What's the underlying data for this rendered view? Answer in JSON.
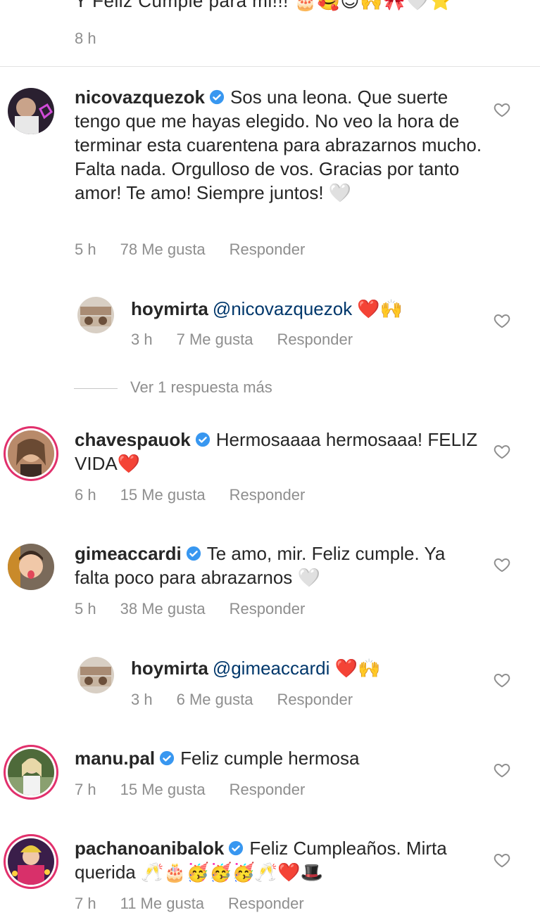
{
  "top": {
    "text": "Y Feliz Cumple para mi!!! 🎂🥰😇🙌🎀🤍⭐",
    "time": "8 h"
  },
  "comments": [
    {
      "username": "nicovazquezok",
      "text": "Sos una leona. Que suerte tengo que me hayas elegido. No veo la hora de terminar esta cuarentena para abrazarnos mucho. Falta nada. Orgulloso de vos. Gracias por tanto amor! Te amo! Siempre juntos! ",
      "emoji": "🤍",
      "time": "5 h",
      "likes": "78 Me gusta",
      "reply": "Responder"
    },
    {
      "username": "hoymirta",
      "mention": "@nicovazquezok",
      "text": "",
      "emoji": " ❤️🙌",
      "time": "3 h",
      "likes": "7 Me gusta",
      "reply": "Responder"
    },
    {
      "username": "chavespauok",
      "text": "Hermosaaaa hermosaaa! FELIZ VIDA",
      "emoji": "❤️",
      "time": "6 h",
      "likes": "15 Me gusta",
      "reply": "Responder"
    },
    {
      "username": "gimeaccardi",
      "text": "Te amo, mir. Feliz cumple. Ya falta poco para abrazarnos ",
      "emoji": "🤍",
      "time": "5 h",
      "likes": "38 Me gusta",
      "reply": "Responder"
    },
    {
      "username": "hoymirta",
      "mention": "@gimeaccardi",
      "text": "",
      "emoji": " ❤️🙌",
      "time": "3 h",
      "likes": "6 Me gusta",
      "reply": "Responder"
    },
    {
      "username": "manu.pal",
      "text": "Feliz cumple hermosa",
      "emoji": "",
      "time": "7 h",
      "likes": "15 Me gusta",
      "reply": "Responder"
    },
    {
      "username": "pachanoanibalok",
      "text": "Feliz Cumpleaños. Mirta querida ",
      "emoji": "🥂🎂🥳🥳🥳🥂❤️🎩",
      "time": "7 h",
      "likes": "11 Me gusta",
      "reply": "Responder"
    }
  ],
  "view_more": "Ver 1 respuesta más",
  "colors": {
    "verified": "#3897f0",
    "story_ring": "#e1306c",
    "muted": "#8e8e8e",
    "text": "#262626"
  },
  "icons": {
    "verified": "verified-badge-icon",
    "heart": "heart-outline-icon"
  }
}
